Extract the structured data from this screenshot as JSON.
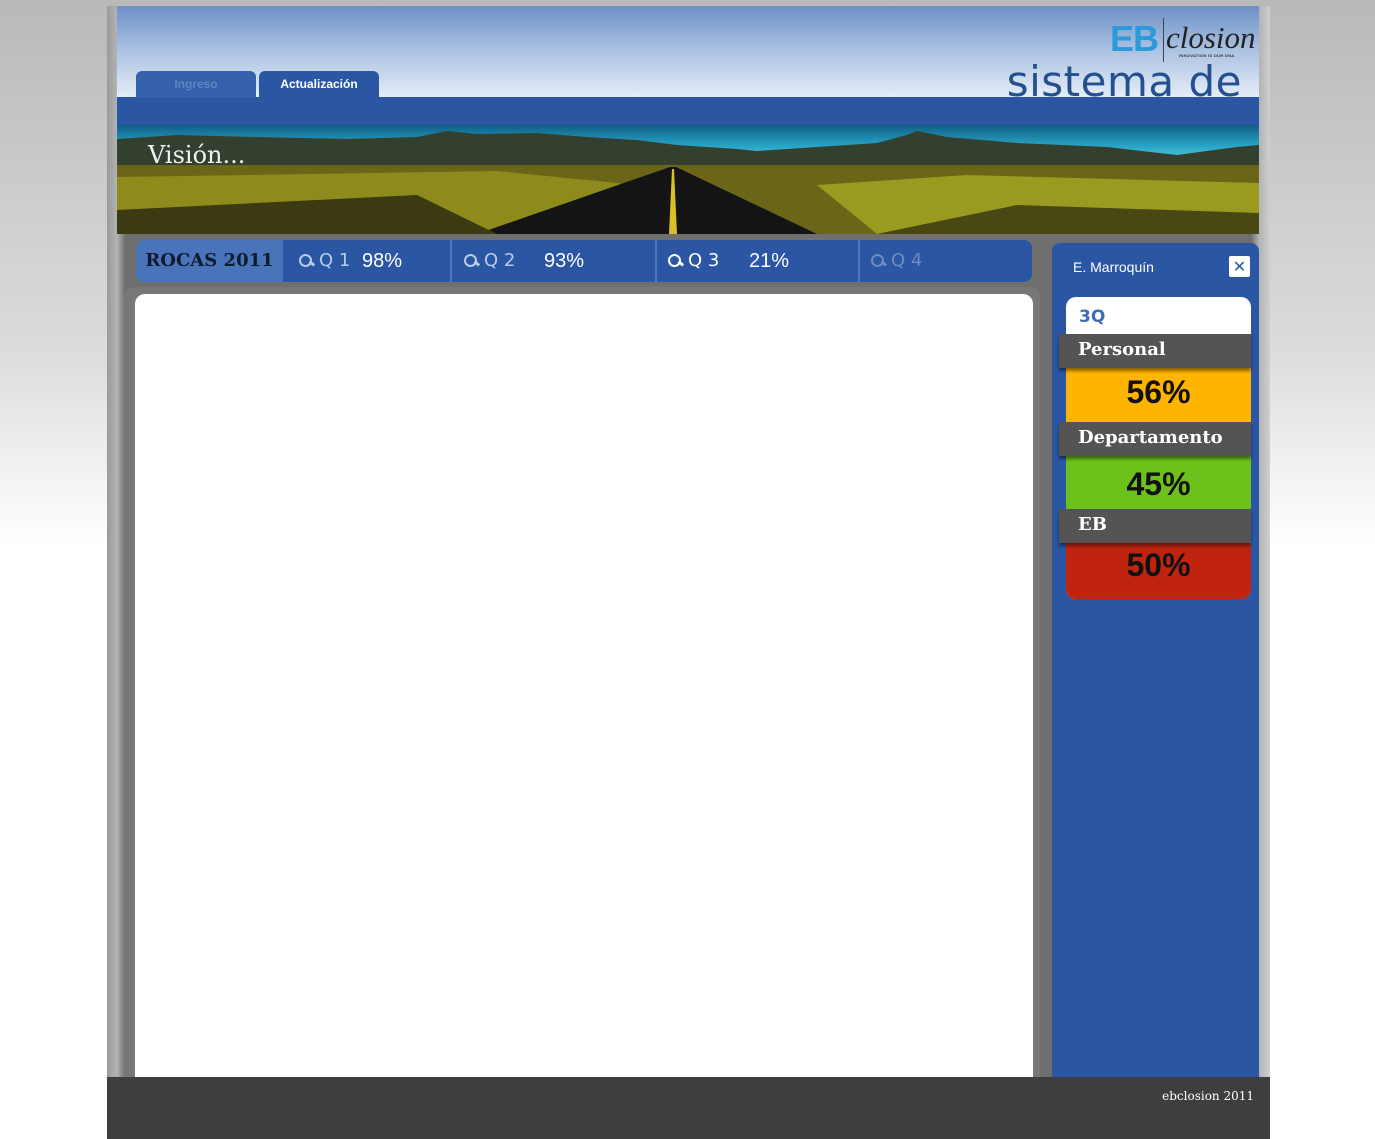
{
  "header": {
    "tabs": [
      {
        "label": "Ingreso",
        "active": false
      },
      {
        "label": "Actualización",
        "active": true
      }
    ],
    "logo": {
      "brand": "EB",
      "suffix": "closion",
      "tagline": "INNOVATION IS OUR DNA"
    },
    "app_title": "sistema de rocas"
  },
  "banner": {
    "caption": "Visión..."
  },
  "quarters": {
    "year_label": "ROCAS 2011",
    "items": [
      {
        "label": "Q 1",
        "value": "98%",
        "state": "past"
      },
      {
        "label": "Q 2",
        "value": "93%",
        "state": "past"
      },
      {
        "label": "Q 3",
        "value": "21%",
        "state": "current"
      },
      {
        "label": "Q 4",
        "value": "",
        "state": "future"
      }
    ]
  },
  "side_panel": {
    "user": "E. Marroquín",
    "close_icon": "close-icon",
    "card_title": "3Q",
    "metrics": [
      {
        "label": "Personal",
        "value": "56%",
        "color": "#ffb400"
      },
      {
        "label": "Departamento",
        "value": "45%",
        "color": "#6cc11a"
      },
      {
        "label": "EB",
        "value": "50%",
        "color": "#c0240f"
      }
    ]
  },
  "footer": {
    "text": "ebclosion 2011"
  },
  "colors": {
    "primary": "#2a56a3",
    "accent": "#2c9ad8",
    "footer": "#3e3e3e"
  }
}
